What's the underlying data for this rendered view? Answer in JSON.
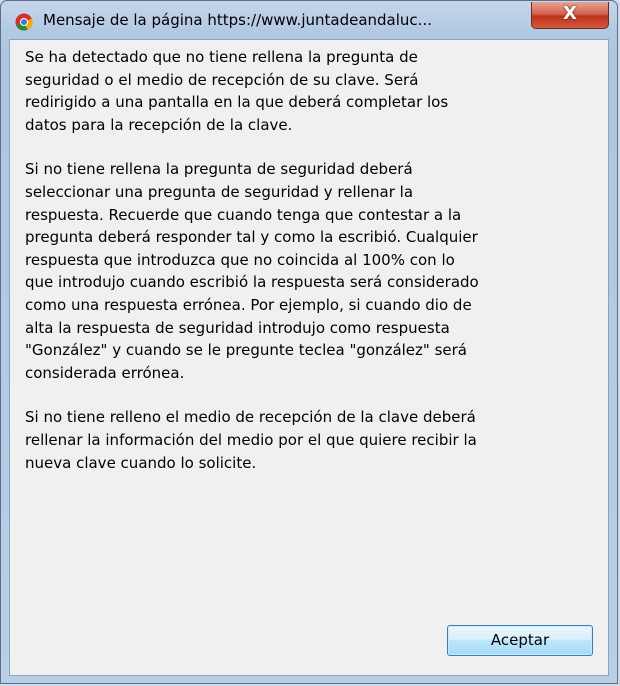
{
  "window": {
    "title": "Mensaje de la página https://www.juntadeandaluc...",
    "close_label": "X",
    "title_icon": "chrome-icon"
  },
  "message": {
    "paragraphs": [
      "Se ha detectado que no tiene rellena la pregunta de\nseguridad o el medio de recepción de su clave. Será\nredirigido a una pantalla en la que deberá completar los\ndatos para la recepción de la clave.",
      "Si no tiene rellena la pregunta de seguridad deberá\nseleccionar una pregunta de seguridad y rellenar la\nrespuesta. Recuerde que cuando tenga que contestar a la\npregunta deberá responder tal y como la escribió. Cualquier\nrespuesta que introduzca que no coincida al 100% con lo\nque introdujo cuando escribió la respuesta será considerado\ncomo una respuesta errónea. Por ejemplo, si cuando dio de\nalta la respuesta de seguridad introdujo como respuesta\n\"González\" y cuando se le pregunte teclea \"gonzález\" será\nconsiderada errónea.",
      "Si no tiene relleno el medio de recepción de la clave deberá\nrellenar la información del medio por el que quiere recibir la\nnueva clave cuando lo solicite."
    ]
  },
  "buttons": {
    "ok_label": "Aceptar"
  },
  "colors": {
    "frame": "#b3c9e3",
    "close_button": "#c1321a",
    "dialog_body": "#f0f0f0",
    "ok_button_border": "#3c7fb1"
  }
}
